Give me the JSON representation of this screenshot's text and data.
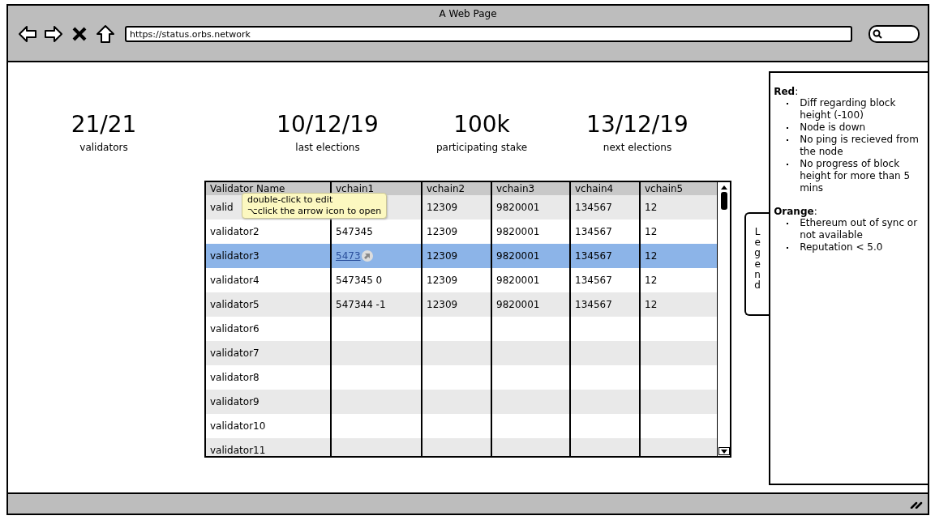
{
  "window": {
    "title": "A Web Page",
    "url": "https://status.orbs.network"
  },
  "stats": [
    {
      "value": "21/21",
      "label": "validators"
    },
    {
      "value": "10/12/19",
      "label": "last elections"
    },
    {
      "value": "100k",
      "label": "participating stake"
    },
    {
      "value": "13/12/19",
      "label": "next elections"
    }
  ],
  "table": {
    "columns": [
      "Validator Name",
      "vchain1",
      "vchain2",
      "vchain3",
      "vchain4",
      "vchain5"
    ],
    "rows": [
      {
        "selected": false,
        "cells": [
          "valid",
          null,
          "12309",
          "9820001",
          "134567",
          "12"
        ]
      },
      {
        "selected": false,
        "cells": [
          "validator2",
          "547345",
          "12309",
          "9820001",
          "134567",
          "12"
        ]
      },
      {
        "selected": true,
        "cells": [
          "validator3",
          {
            "text": "5473",
            "kind": "link"
          },
          "12309",
          "9820001",
          "134567",
          "12"
        ]
      },
      {
        "selected": false,
        "cells": [
          "validator4",
          "547345 0",
          "12309",
          "9820001",
          "134567",
          "12"
        ]
      },
      {
        "selected": false,
        "cells": [
          "validator5",
          "547344 -1",
          "12309",
          "9820001",
          "134567",
          "12"
        ]
      },
      {
        "selected": false,
        "cells": [
          "validator6"
        ]
      },
      {
        "selected": false,
        "cells": [
          "validator7"
        ]
      },
      {
        "selected": false,
        "cells": [
          "validator8"
        ]
      },
      {
        "selected": false,
        "cells": [
          "validator9"
        ]
      },
      {
        "selected": false,
        "cells": [
          "validator10"
        ]
      },
      {
        "selected": false,
        "cells": [
          "validator11"
        ]
      }
    ],
    "tooltip": [
      "double-click to edit",
      "⌥click the arrow icon to open"
    ]
  },
  "legend": {
    "tab": "Legend",
    "sections": [
      {
        "title": "**Red**:",
        "items": [
          "Diff regarding block height (-100)",
          "Node is down",
          "No ping is recieved from the node",
          "No progress of block height for more than 5 mins"
        ]
      },
      {
        "title": "**Orange**:",
        "items": [
          "Ethereum out of sync or not available",
          "Reputation < 5.0"
        ]
      }
    ]
  }
}
